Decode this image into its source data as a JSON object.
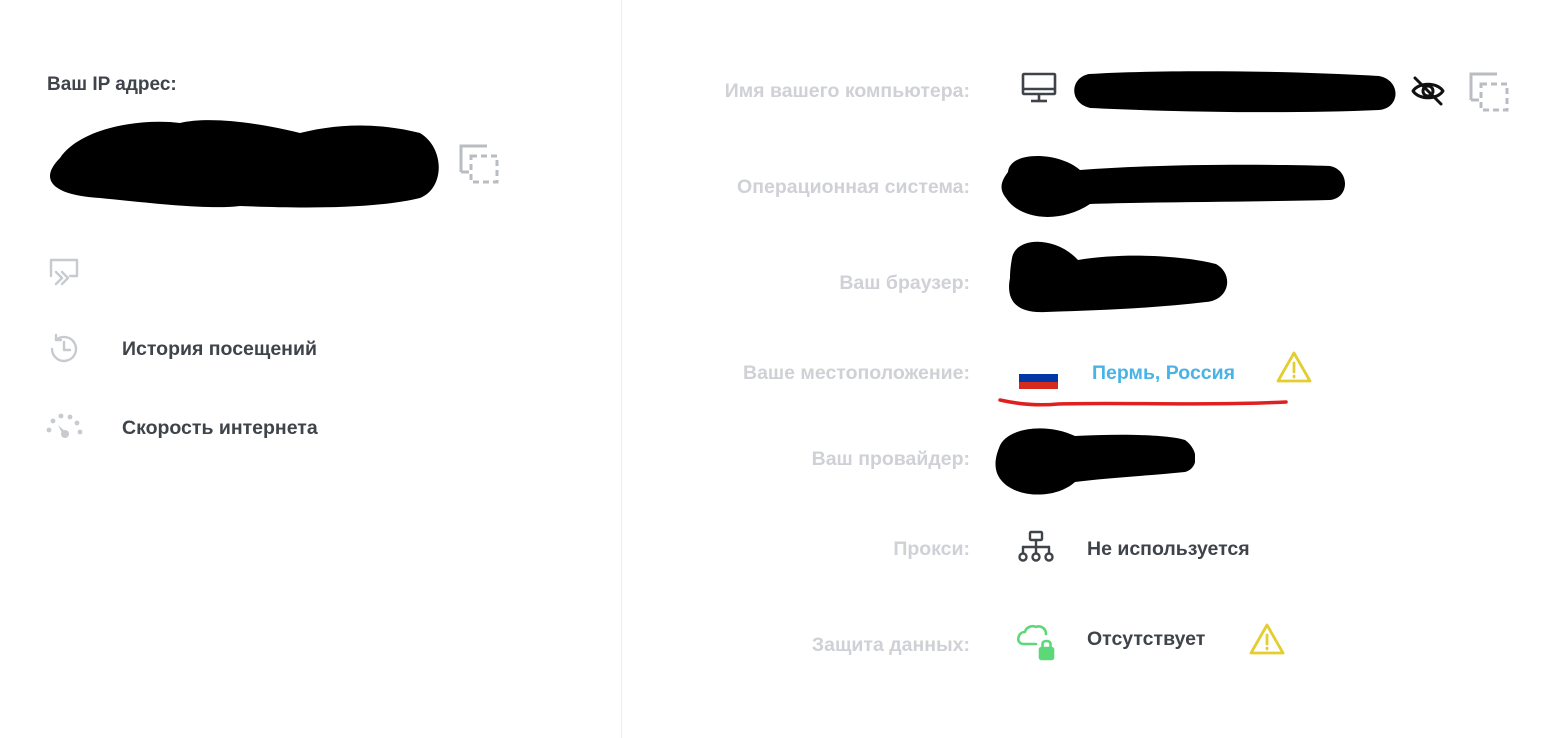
{
  "left": {
    "ip_title": "Ваш IP адрес:",
    "nav": [
      {
        "label": "История посещений",
        "icon": "history-icon"
      },
      {
        "label": "Скорость интернета",
        "icon": "speedometer-icon"
      }
    ]
  },
  "right": {
    "computer_name": {
      "label": "Имя вашего компьютера:",
      "icon": "monitor-icon"
    },
    "os": {
      "label": "Операционная система:"
    },
    "browser": {
      "label": "Ваш браузер:"
    },
    "location": {
      "label": "Ваше местоположение:",
      "value": "Пермь, Россия",
      "flag": "russia-flag",
      "flag_colors": [
        "#ffffff",
        "#0039a6",
        "#d52b1e"
      ],
      "warning": "warning-icon"
    },
    "provider": {
      "label": "Ваш провайдер:"
    },
    "proxy": {
      "label": "Прокси:",
      "value": "Не используется",
      "icon": "network-icon"
    },
    "protection": {
      "label": "Защита данных:",
      "value": "Отсутствует",
      "icon": "cloud-lock-icon",
      "warning": "warning-icon"
    }
  },
  "colors": {
    "accent_blue": "#4ab3e6",
    "warning_yellow": "#e3cd2f",
    "cloud_green": "#5dd879",
    "label_gray": "#cfd1d6",
    "text_dark": "#3f434a",
    "redaction_black": "#000000",
    "underline_red": "#e0201e"
  }
}
